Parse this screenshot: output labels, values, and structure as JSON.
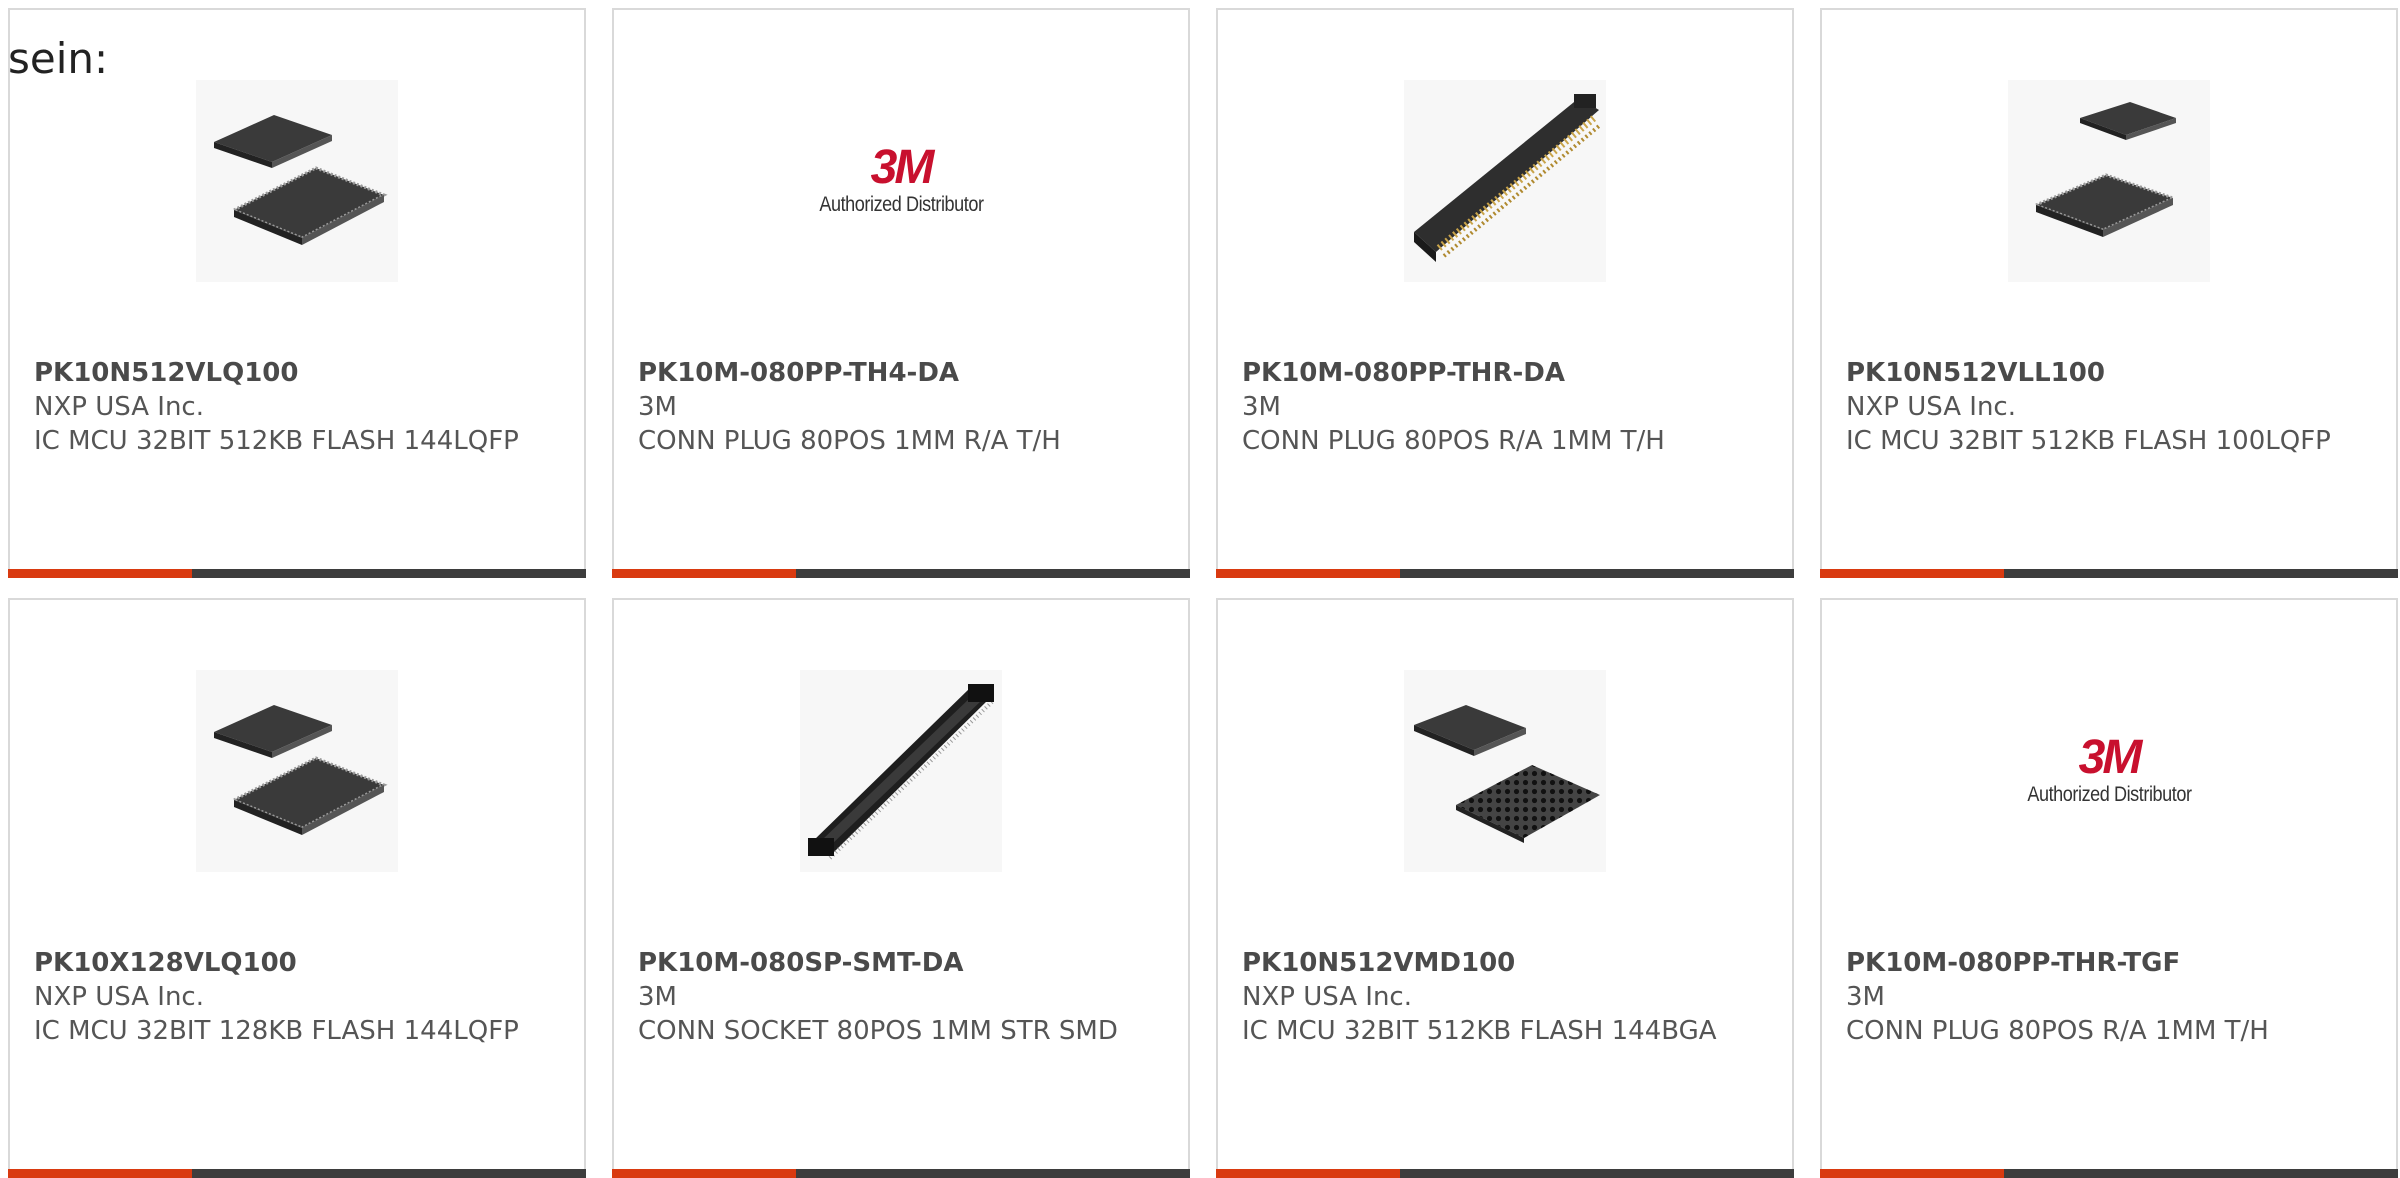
{
  "intro_text": "sein:",
  "products": [
    {
      "part_number": "PK10N512VLQ100",
      "manufacturer": "NXP USA Inc.",
      "description": "IC MCU 32BIT 512KB FLASH 144LQFP",
      "image": "chip-qfp-pair-icon"
    },
    {
      "part_number": "PK10M-080PP-TH4-DA",
      "manufacturer": "3M",
      "description": "CONN PLUG 80POS 1MM R/A T/H",
      "image": "3m-logo"
    },
    {
      "part_number": "PK10M-080PP-THR-DA",
      "manufacturer": "3M",
      "description": "CONN PLUG 80POS R/A 1MM T/H",
      "image": "connector-header-icon"
    },
    {
      "part_number": "PK10N512VLL100",
      "manufacturer": "NXP USA Inc.",
      "description": "IC MCU 32BIT 512KB FLASH 100LQFP",
      "image": "chip-qfp-pair-icon"
    },
    {
      "part_number": "PK10X128VLQ100",
      "manufacturer": "NXP USA Inc.",
      "description": "IC MCU 32BIT 128KB FLASH 144LQFP",
      "image": "chip-qfp-pair-icon"
    },
    {
      "part_number": "PK10M-080SP-SMT-DA",
      "manufacturer": "3M",
      "description": "CONN SOCKET 80POS 1MM STR SMD",
      "image": "connector-socket-icon"
    },
    {
      "part_number": "PK10N512VMD100",
      "manufacturer": "NXP USA Inc.",
      "description": "IC MCU 32BIT 512KB FLASH 144BGA",
      "image": "chip-bga-icon"
    },
    {
      "part_number": "PK10M-080PP-THR-TGF",
      "manufacturer": "3M",
      "description": "CONN PLUG 80POS R/A 1MM T/H",
      "image": "3m-logo"
    }
  ],
  "logo_3m": {
    "mark": "3M",
    "tagline": "Authorized Distributor"
  },
  "colors": {
    "accent": "#d93a10",
    "bar": "#3d3d3d",
    "border": "#d9d9d9",
    "text": "#555555"
  }
}
